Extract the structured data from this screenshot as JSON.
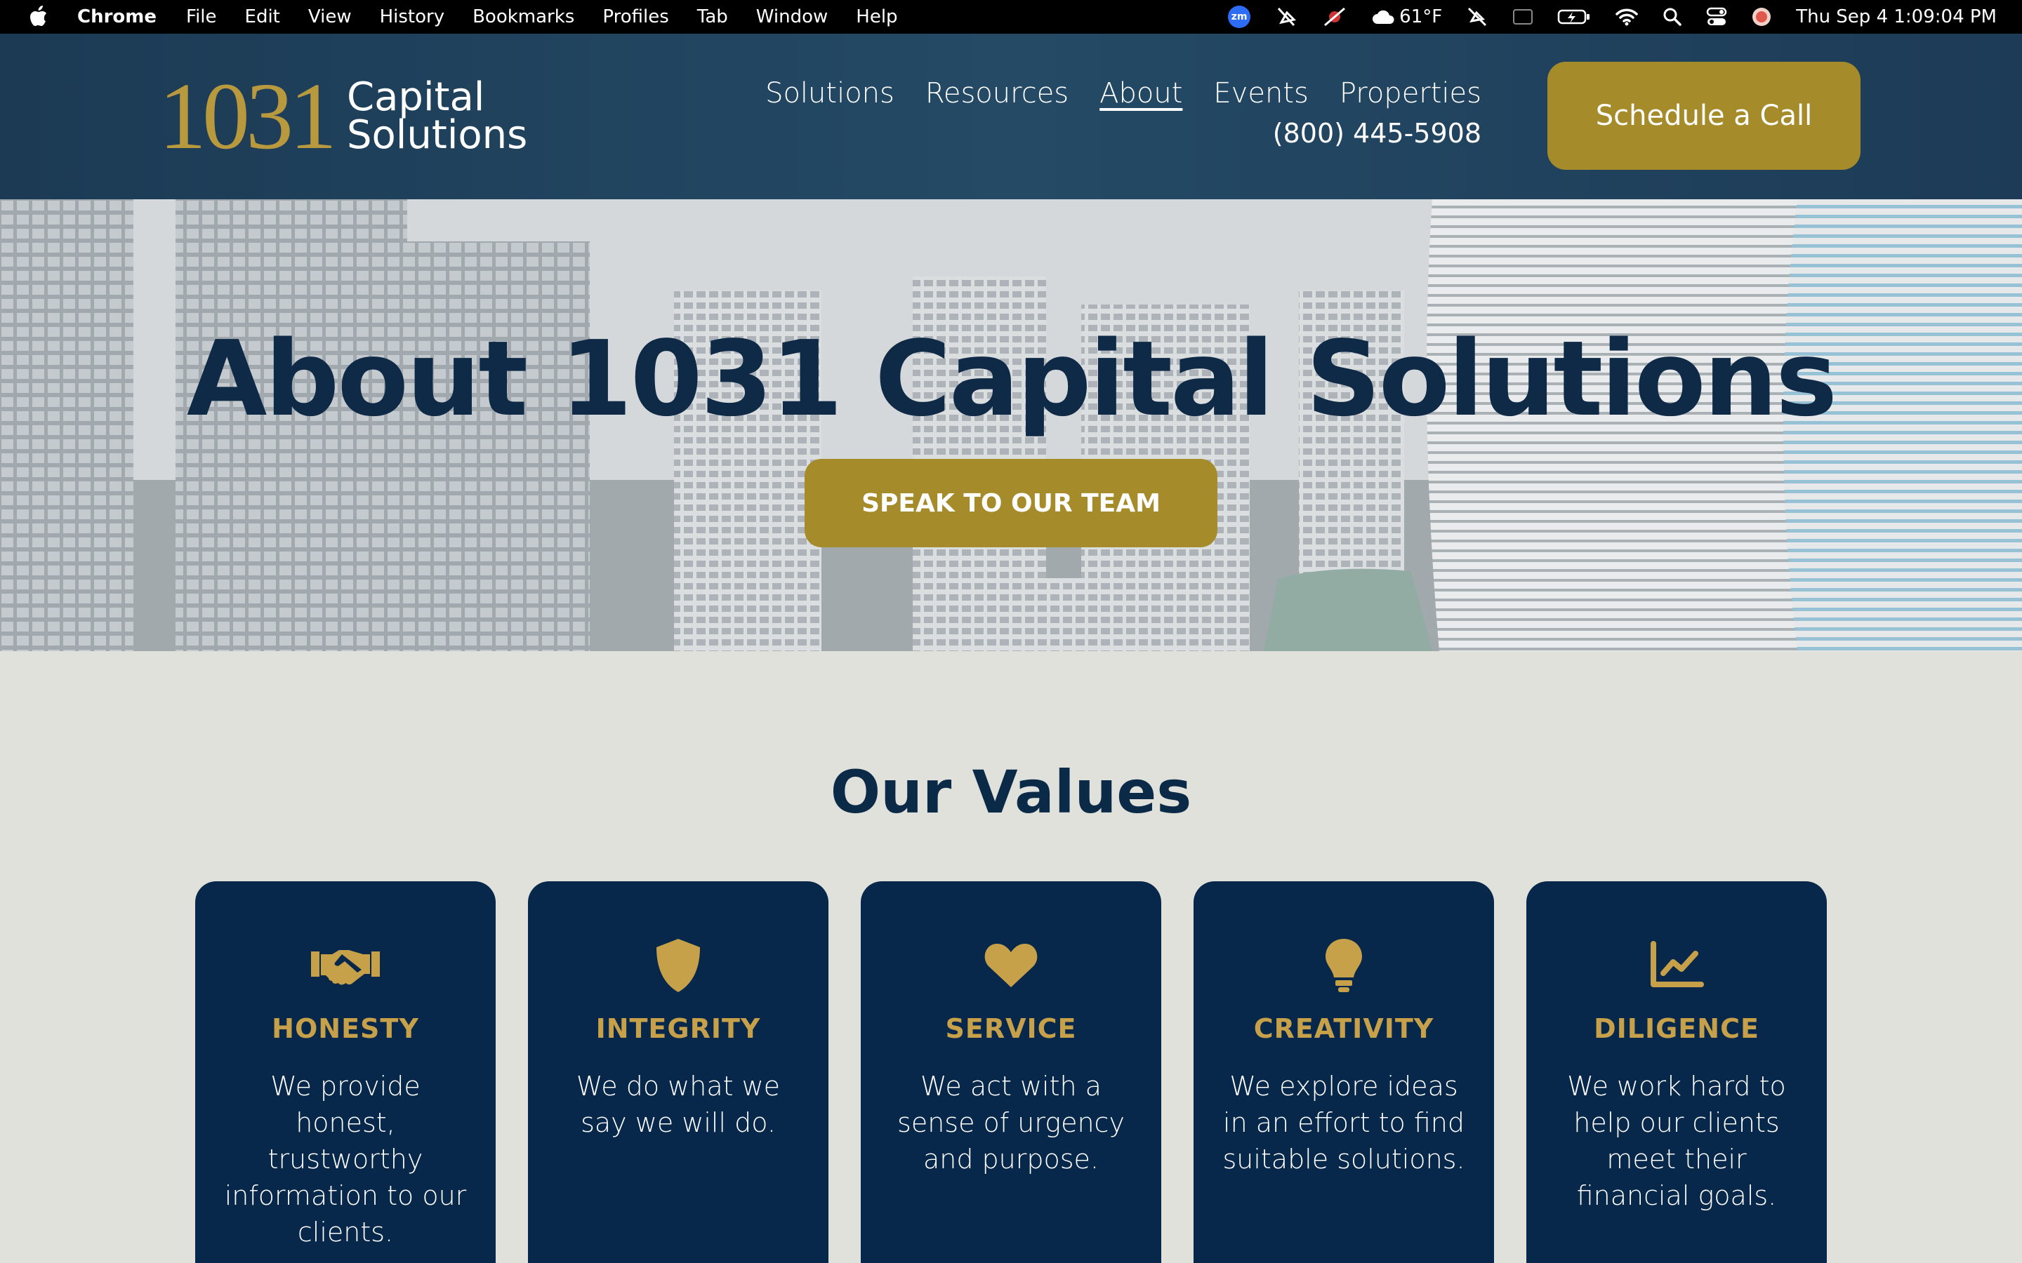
{
  "menubar": {
    "app_name": "Chrome",
    "items": [
      "File",
      "Edit",
      "View",
      "History",
      "Bookmarks",
      "Profiles",
      "Tab",
      "Window",
      "Help"
    ],
    "status": {
      "zoom_badge": "zm",
      "temperature": "61°F",
      "datetime": "Thu Sep 4  1:09:04 PM"
    }
  },
  "header": {
    "logo_number": "1031",
    "logo_line1": "Capital",
    "logo_line2": "Solutions",
    "nav": [
      "Solutions",
      "Resources",
      "About",
      "Events",
      "Properties"
    ],
    "active_nav": "About",
    "phone": "(800) 445-5908",
    "cta": "Schedule a Call"
  },
  "hero": {
    "title": "About 1031 Capital Solutions",
    "cta": "SPEAK TO OUR TEAM"
  },
  "values": {
    "heading": "Our Values",
    "cards": [
      {
        "icon": "handshake-icon",
        "title": "HONESTY",
        "text": "We provide honest, trustworthy information to our clients."
      },
      {
        "icon": "shield-icon",
        "title": "INTEGRITY",
        "text": "We do what we say we will do."
      },
      {
        "icon": "heart-icon",
        "title": "SERVICE",
        "text": "We act with a sense of urgency and purpose."
      },
      {
        "icon": "lightbulb-icon",
        "title": "CREATIVITY",
        "text": "We explore ideas in an effort to find suitable solutions."
      },
      {
        "icon": "line-chart-icon",
        "title": "DILIGENCE",
        "text": "We work hard to help our clients meet their financial goals."
      }
    ]
  },
  "colors": {
    "navy": "#07284a",
    "header": "#244a66",
    "gold": "#a58b2a",
    "gold_text": "#c7a04a",
    "background": "#e1e1dc"
  }
}
